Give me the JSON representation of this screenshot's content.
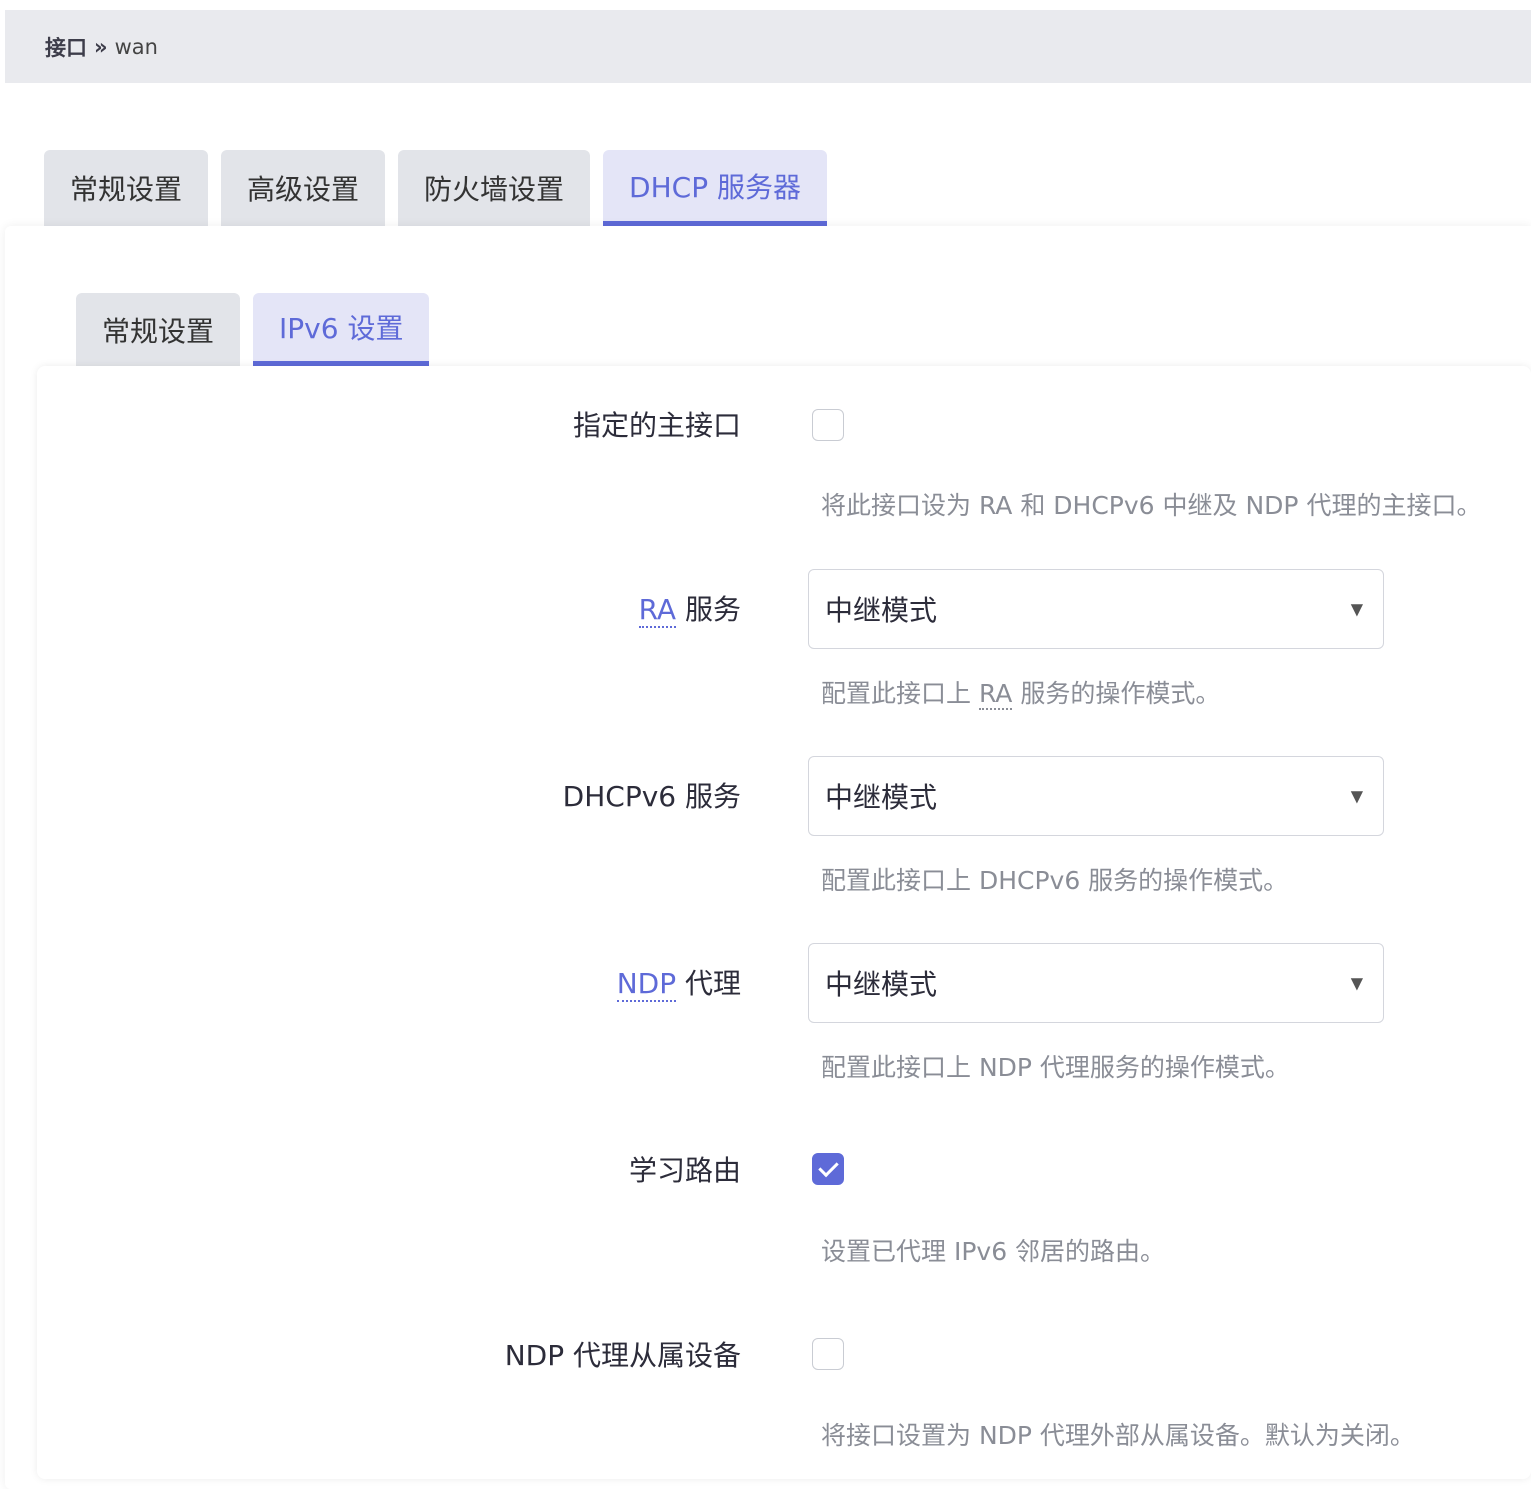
{
  "breadcrumb": {
    "parent": "接口",
    "separator": "»",
    "current": "wan"
  },
  "outer_tabs": [
    {
      "label": "常规设置",
      "active": false
    },
    {
      "label": "高级设置",
      "active": false
    },
    {
      "label": "防火墙设置",
      "active": false
    },
    {
      "label": "DHCP 服务器",
      "active": true
    }
  ],
  "inner_tabs": [
    {
      "label": "常规设置",
      "active": false
    },
    {
      "label": "IPv6 设置",
      "active": true
    }
  ],
  "form": {
    "master": {
      "label": "指定的主接口",
      "checked": false,
      "help": "将此接口设为 RA 和 DHCPv6 中继及 NDP 代理的主接口。"
    },
    "ra": {
      "label_abbr": "RA",
      "label_rest": " 服务",
      "value": "中继模式",
      "help_prefix": "配置此接口上 ",
      "help_abbr": "RA",
      "help_suffix": " 服务的操作模式。"
    },
    "dhcpv6": {
      "label": "DHCPv6 服务",
      "value": "中继模式",
      "help": "配置此接口上 DHCPv6 服务的操作模式。"
    },
    "ndp": {
      "label_abbr": "NDP",
      "label_rest": " 代理",
      "value": "中继模式",
      "help": "配置此接口上 NDP 代理服务的操作模式。"
    },
    "learn_routes": {
      "label": "学习路由",
      "checked": true,
      "help": "设置已代理 IPv6 邻居的路由。"
    },
    "ndp_slave": {
      "label": "NDP 代理从属设备",
      "checked": false,
      "help": "将接口设置为 NDP 代理外部从属设备。默认为关闭。"
    }
  },
  "icons": {
    "select_caret": "caret-down-icon",
    "check": "check-icon"
  },
  "colors": {
    "accent": "#5e6ad8",
    "tab_bg": "#e2e4e9",
    "help_text": "#8a8d96"
  }
}
